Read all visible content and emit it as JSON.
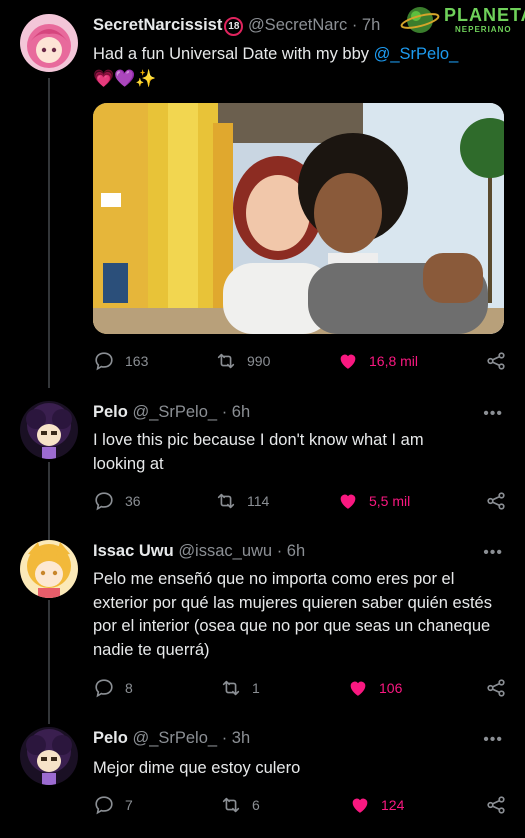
{
  "watermark": {
    "brand": "PLANETA",
    "sub": "NEPERIANO"
  },
  "tweets": [
    {
      "name": "SecretNarcissist",
      "badge": "18",
      "handle": "@SecretNarc",
      "time": "· 7h",
      "text_prefix": "Had a fun Universal Date with my bby ",
      "mention": "@_SrPelo_",
      "emoji": "💗💜✨",
      "replies": "163",
      "retweets": "990",
      "likes": "16,8 mil"
    },
    {
      "name": "Pelo",
      "handle": "@_SrPelo_",
      "time": "· 6h",
      "text": "I love this pic because I don't know what I am looking at",
      "replies": "36",
      "retweets": "114",
      "likes": "5,5 mil",
      "more": "•••"
    },
    {
      "name": "Issac Uwu",
      "handle": "@issac_uwu",
      "time": "· 6h",
      "text": "Pelo me enseñó que no importa como eres por el exterior por qué las mujeres quieren saber quién estés por el interior (osea que no por que seas un chaneque nadie te querrá)",
      "replies": "8",
      "retweets": "1",
      "likes": "106",
      "more": "•••"
    },
    {
      "name": "Pelo",
      "handle": "@_SrPelo_",
      "time": "· 3h",
      "text": "Mejor dime que estoy culero",
      "replies": "7",
      "retweets": "6",
      "likes": "124",
      "more": "•••"
    }
  ]
}
